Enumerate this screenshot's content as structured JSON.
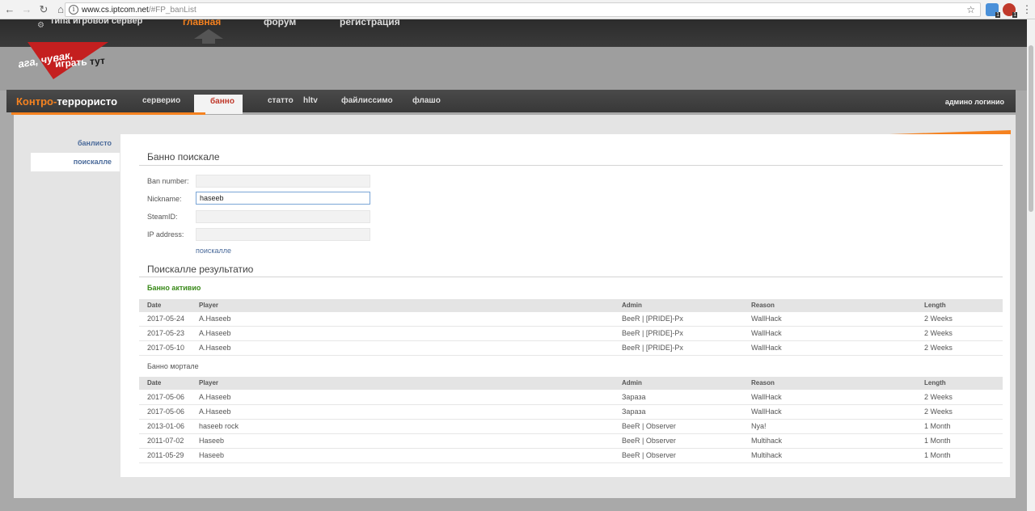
{
  "browser": {
    "url_host": "www.cs.iptcom.net",
    "url_path": "/#FP_banList",
    "ext_badge_1": "1",
    "ext_badge_2": "1"
  },
  "site": {
    "top_tabs": {
      "left": "типа игровой сервер",
      "main": "главная",
      "forum": "форум",
      "register": "регистрация"
    },
    "logo": {
      "line1a": "ага,",
      "line1b": "чувак,",
      "line2a": "играть",
      "line2b": "тут"
    },
    "section_title_a": "Контро-",
    "section_title_b": "террористо",
    "nav": [
      "серверио",
      "банно",
      "статто",
      "hltv",
      "файлиссимо",
      "флашо"
    ],
    "admin_login": "админо логинио"
  },
  "sidebar": {
    "items": [
      {
        "label": "банлисто"
      },
      {
        "label": "поискалле"
      }
    ]
  },
  "search": {
    "heading": "Банно поискале",
    "fields": [
      {
        "label": "Ban number:",
        "value": ""
      },
      {
        "label": "Nickname:",
        "value": "haseeb"
      },
      {
        "label": "SteamID:",
        "value": ""
      },
      {
        "label": "IP address:",
        "value": ""
      }
    ],
    "submit_label": "поискалле"
  },
  "results": {
    "heading": "Поискалле результатио",
    "active_title": "Банно активио",
    "expired_title": "Банно мортале",
    "columns": [
      "Date",
      "Player",
      "Admin",
      "Reason",
      "Length"
    ],
    "active_rows": [
      [
        "2017-05-24",
        "A.Haseeb",
        "BeeR | [PRIDE]-Px",
        "WallHack",
        "2 Weeks"
      ],
      [
        "2017-05-23",
        "A.Haseeb",
        "BeeR | [PRIDE]-Px",
        "WallHack",
        "2 Weeks"
      ],
      [
        "2017-05-10",
        "A.Haseeb",
        "BeeR | [PRIDE]-Px",
        "WallHack",
        "2 Weeks"
      ]
    ],
    "expired_rows": [
      [
        "2017-05-06",
        "A.Haseeb",
        "Зараза",
        "WallHack",
        "2 Weeks"
      ],
      [
        "2017-05-06",
        "A.Haseeb",
        "Зараза",
        "WallHack",
        "2 Weeks"
      ],
      [
        "2013-01-06",
        "haseeb rock",
        "BeeR | Observer",
        "Nya!",
        "1 Month"
      ],
      [
        "2011-07-02",
        "Haseeb",
        "BeeR | Observer",
        "Multihack",
        "1 Month"
      ],
      [
        "2011-05-29",
        "Haseeb",
        "BeeR | Observer",
        "Multihack",
        "1 Month"
      ]
    ]
  },
  "colors": {
    "accent": "#f58220",
    "active_green": "#3a8a1a",
    "link_blue": "#4a6a9a"
  }
}
